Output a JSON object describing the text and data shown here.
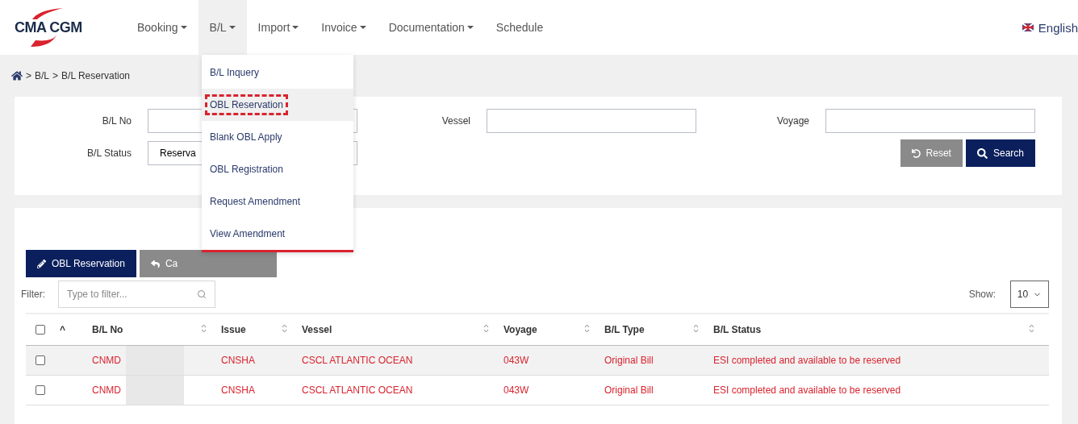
{
  "header": {
    "logo": "CMA CGM",
    "nav": [
      {
        "label": "Booking",
        "selected": false,
        "caret": true
      },
      {
        "label": "B/L",
        "selected": true,
        "caret": true
      },
      {
        "label": "Import",
        "selected": false,
        "caret": true
      },
      {
        "label": "Invoice",
        "selected": false,
        "caret": true
      },
      {
        "label": "Documentation",
        "selected": false,
        "caret": true
      },
      {
        "label": "Schedule",
        "selected": false,
        "caret": false
      }
    ],
    "language": "English"
  },
  "breadcrumb": {
    "separator": ">",
    "items": [
      "B/L",
      "B/L Reservation"
    ]
  },
  "dropdown_menu": {
    "items": [
      {
        "label": "B/L Inquery",
        "selected": false,
        "annotated": false
      },
      {
        "label": "OBL Reservation",
        "selected": true,
        "annotated": true
      },
      {
        "label": "Blank OBL Apply",
        "selected": false,
        "annotated": false
      },
      {
        "label": "OBL Registration",
        "selected": false,
        "annotated": false
      },
      {
        "label": "Request Amendment",
        "selected": false,
        "annotated": false
      },
      {
        "label": "View Amendment",
        "selected": false,
        "annotated": false
      }
    ]
  },
  "search_form": {
    "fields": [
      {
        "label": "B/L No"
      },
      {
        "label": "Vessel"
      },
      {
        "label": "Voyage"
      },
      {
        "label": "B/L Status",
        "value": "Reserva"
      }
    ],
    "buttons": [
      {
        "label": "Reset",
        "kind": "secondary"
      },
      {
        "label": "Search",
        "kind": "primary"
      }
    ]
  },
  "toolbar": {
    "buttons": [
      {
        "label": "OBL Reservation",
        "kind": "primary"
      },
      {
        "label": "Ca",
        "kind": "secondary"
      }
    ],
    "filter": {
      "label": "Filter:",
      "placeholder": "Type to filter..."
    },
    "show": {
      "label": "Show:",
      "value": "10"
    }
  },
  "table": {
    "select_all_checked": false,
    "sort_mark": "^",
    "columns": [
      "B/L No",
      "Issue",
      "Vessel",
      "Voyage",
      "B/L Type",
      "B/L Status"
    ],
    "rows": [
      {
        "checked": false,
        "redacted": true,
        "cells": [
          "CNMD",
          "CNSHA",
          "CSCL ATLANTIC OCEAN",
          "043W",
          "Original Bill",
          "ESI completed and available to be reserved"
        ]
      },
      {
        "checked": false,
        "redacted": true,
        "cells": [
          "CNMD",
          "CNSHA",
          "CSCL ATLANTIC OCEAN",
          "043W",
          "Original Bill",
          "ESI completed and available to be reserved"
        ]
      }
    ]
  }
}
